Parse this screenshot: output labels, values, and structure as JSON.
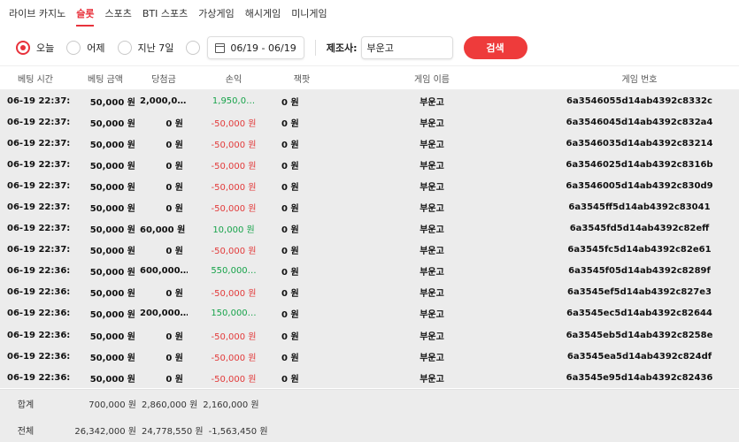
{
  "tabs": [
    {
      "label": "라이브 카지노",
      "active": false
    },
    {
      "label": "슬롯",
      "active": true
    },
    {
      "label": "스포츠",
      "active": false
    },
    {
      "label": "BTI 스포츠",
      "active": false
    },
    {
      "label": "가상게임",
      "active": false
    },
    {
      "label": "해시게임",
      "active": false
    },
    {
      "label": "미니게임",
      "active": false
    }
  ],
  "filters": {
    "radios": [
      {
        "label": "오늘",
        "selected": true
      },
      {
        "label": "어제",
        "selected": false
      },
      {
        "label": "지난 7일",
        "selected": false
      },
      {
        "label": "",
        "selected": false
      }
    ],
    "date_range": "06/19 - 06/19",
    "maker_label": "제조사:",
    "maker_value": "부운고",
    "search_label": "검색"
  },
  "table": {
    "headers": [
      "베팅 시간",
      "베팅 금액",
      "당첨금",
      "손익",
      "잭팟",
      "게임 이름",
      "게임 번호"
    ],
    "rows": [
      {
        "time": "06-19 22:37:…",
        "bet": "50,000 원",
        "win": "2,000,0…",
        "pnl": "1,950,0…",
        "pnl_sign": "pos",
        "jackpot": "0 원",
        "game": "부운고",
        "id": "6a3546055d14ab4392c8332c"
      },
      {
        "time": "06-19 22:37:…",
        "bet": "50,000 원",
        "win": "0 원",
        "pnl": "-50,000 원",
        "pnl_sign": "neg",
        "jackpot": "0 원",
        "game": "부운고",
        "id": "6a3546045d14ab4392c832a4"
      },
      {
        "time": "06-19 22:37:…",
        "bet": "50,000 원",
        "win": "0 원",
        "pnl": "-50,000 원",
        "pnl_sign": "neg",
        "jackpot": "0 원",
        "game": "부운고",
        "id": "6a3546035d14ab4392c83214"
      },
      {
        "time": "06-19 22:37:…",
        "bet": "50,000 원",
        "win": "0 원",
        "pnl": "-50,000 원",
        "pnl_sign": "neg",
        "jackpot": "0 원",
        "game": "부운고",
        "id": "6a3546025d14ab4392c8316b"
      },
      {
        "time": "06-19 22:37:…",
        "bet": "50,000 원",
        "win": "0 원",
        "pnl": "-50,000 원",
        "pnl_sign": "neg",
        "jackpot": "0 원",
        "game": "부운고",
        "id": "6a3546005d14ab4392c830d9"
      },
      {
        "time": "06-19 22:37:…",
        "bet": "50,000 원",
        "win": "0 원",
        "pnl": "-50,000 원",
        "pnl_sign": "neg",
        "jackpot": "0 원",
        "game": "부운고",
        "id": "6a3545ff5d14ab4392c83041"
      },
      {
        "time": "06-19 22:37:…",
        "bet": "50,000 원",
        "win": "60,000 원",
        "pnl": "10,000 원",
        "pnl_sign": "pos",
        "jackpot": "0 원",
        "game": "부운고",
        "id": "6a3545fd5d14ab4392c82eff"
      },
      {
        "time": "06-19 22:37:…",
        "bet": "50,000 원",
        "win": "0 원",
        "pnl": "-50,000 원",
        "pnl_sign": "neg",
        "jackpot": "0 원",
        "game": "부운고",
        "id": "6a3545fc5d14ab4392c82e61"
      },
      {
        "time": "06-19 22:36:…",
        "bet": "50,000 원",
        "win": "600,000…",
        "pnl": "550,000…",
        "pnl_sign": "pos",
        "jackpot": "0 원",
        "game": "부운고",
        "id": "6a3545f05d14ab4392c8289f"
      },
      {
        "time": "06-19 22:36:…",
        "bet": "50,000 원",
        "win": "0 원",
        "pnl": "-50,000 원",
        "pnl_sign": "neg",
        "jackpot": "0 원",
        "game": "부운고",
        "id": "6a3545ef5d14ab4392c827e3"
      },
      {
        "time": "06-19 22:36:…",
        "bet": "50,000 원",
        "win": "200,000…",
        "pnl": "150,000…",
        "pnl_sign": "pos",
        "jackpot": "0 원",
        "game": "부운고",
        "id": "6a3545ec5d14ab4392c82644"
      },
      {
        "time": "06-19 22:36:…",
        "bet": "50,000 원",
        "win": "0 원",
        "pnl": "-50,000 원",
        "pnl_sign": "neg",
        "jackpot": "0 원",
        "game": "부운고",
        "id": "6a3545eb5d14ab4392c8258e"
      },
      {
        "time": "06-19 22:36:…",
        "bet": "50,000 원",
        "win": "0 원",
        "pnl": "-50,000 원",
        "pnl_sign": "neg",
        "jackpot": "0 원",
        "game": "부운고",
        "id": "6a3545ea5d14ab4392c824df"
      },
      {
        "time": "06-19 22:36:…",
        "bet": "50,000 원",
        "win": "0 원",
        "pnl": "-50,000 원",
        "pnl_sign": "neg",
        "jackpot": "0 원",
        "game": "부운고",
        "id": "6a3545e95d14ab4392c82436"
      }
    ]
  },
  "totals": {
    "subtotal": {
      "label": "합계",
      "bet": "700,000 원",
      "win": "2,860,000 원",
      "pnl": "2,160,000 원",
      "pnl_sign": "pos"
    },
    "overall": {
      "label": "전체",
      "bet": "26,342,000 원",
      "win": "24,778,550 원",
      "pnl": "-1,563,450 원",
      "pnl_sign": "neg"
    }
  },
  "colors": {
    "accent": "#e8323c",
    "positive": "#17a34a",
    "negative": "#e23a3a",
    "row_bg": "#ececec"
  }
}
